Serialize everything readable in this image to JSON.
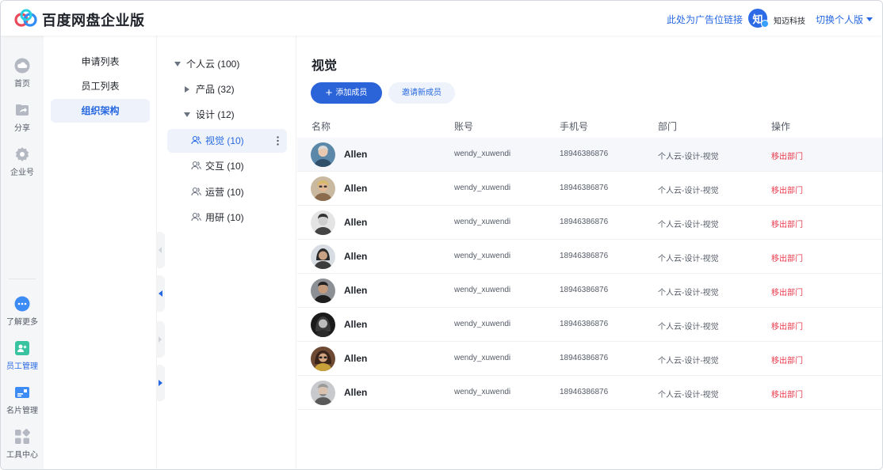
{
  "header": {
    "brand": "百度网盘企业版",
    "ad_link": "此处为广告位链接",
    "org_avatar_char": "知",
    "org_name": "知迈科技",
    "switch_label": "切换个人版"
  },
  "rail": {
    "items": [
      {
        "label": "首页",
        "icon": "cloud-icon"
      },
      {
        "label": "分享",
        "icon": "share-icon"
      },
      {
        "label": "企业号",
        "icon": "gear-icon"
      },
      {
        "label": "了解更多",
        "icon": "more-icon"
      },
      {
        "label": "员工管理",
        "icon": "staff-icon"
      },
      {
        "label": "名片管理",
        "icon": "card-icon"
      },
      {
        "label": "工具中心",
        "icon": "tools-icon"
      }
    ]
  },
  "subnav": {
    "items": [
      {
        "label": "申请列表"
      },
      {
        "label": "员工列表"
      },
      {
        "label": "组织架构"
      }
    ]
  },
  "tree": {
    "root": "个人云 (100)",
    "product": "产品 (32)",
    "design": "设计 (12)",
    "children": [
      {
        "label": "视觉 (10)"
      },
      {
        "label": "交互 (10)"
      },
      {
        "label": "运营 (10)"
      },
      {
        "label": "用研 (10)"
      }
    ]
  },
  "main": {
    "title": "视觉",
    "add_button": "添加成员",
    "invite_button": "邀请新成员",
    "columns": {
      "name": "名称",
      "account": "账号",
      "phone": "手机号",
      "dept": "部门",
      "action": "操作"
    },
    "rows": [
      {
        "name": "Allen",
        "account": "wendy_xuwendi",
        "phone": "18946386876",
        "dept": "个人云-设计-视觉",
        "action": "移出部门"
      },
      {
        "name": "Allen",
        "account": "wendy_xuwendi",
        "phone": "18946386876",
        "dept": "个人云-设计-视觉",
        "action": "移出部门"
      },
      {
        "name": "Allen",
        "account": "wendy_xuwendi",
        "phone": "18946386876",
        "dept": "个人云-设计-视觉",
        "action": "移出部门"
      },
      {
        "name": "Allen",
        "account": "wendy_xuwendi",
        "phone": "18946386876",
        "dept": "个人云-设计-视觉",
        "action": "移出部门"
      },
      {
        "name": "Allen",
        "account": "wendy_xuwendi",
        "phone": "18946386876",
        "dept": "个人云-设计-视觉",
        "action": "移出部门"
      },
      {
        "name": "Allen",
        "account": "wendy_xuwendi",
        "phone": "18946386876",
        "dept": "个人云-设计-视觉",
        "action": "移出部门"
      },
      {
        "name": "Allen",
        "account": "wendy_xuwendi",
        "phone": "18946386876",
        "dept": "个人云-设计-视觉",
        "action": "移出部门"
      },
      {
        "name": "Allen",
        "account": "wendy_xuwendi",
        "phone": "18946386876",
        "dept": "个人云-设计-视觉",
        "action": "移出部门"
      }
    ]
  },
  "colors": {
    "accent": "#2668e2",
    "primary_button": "#2b63d9",
    "danger": "#e8374a",
    "active_bg": "#eef2fa"
  }
}
